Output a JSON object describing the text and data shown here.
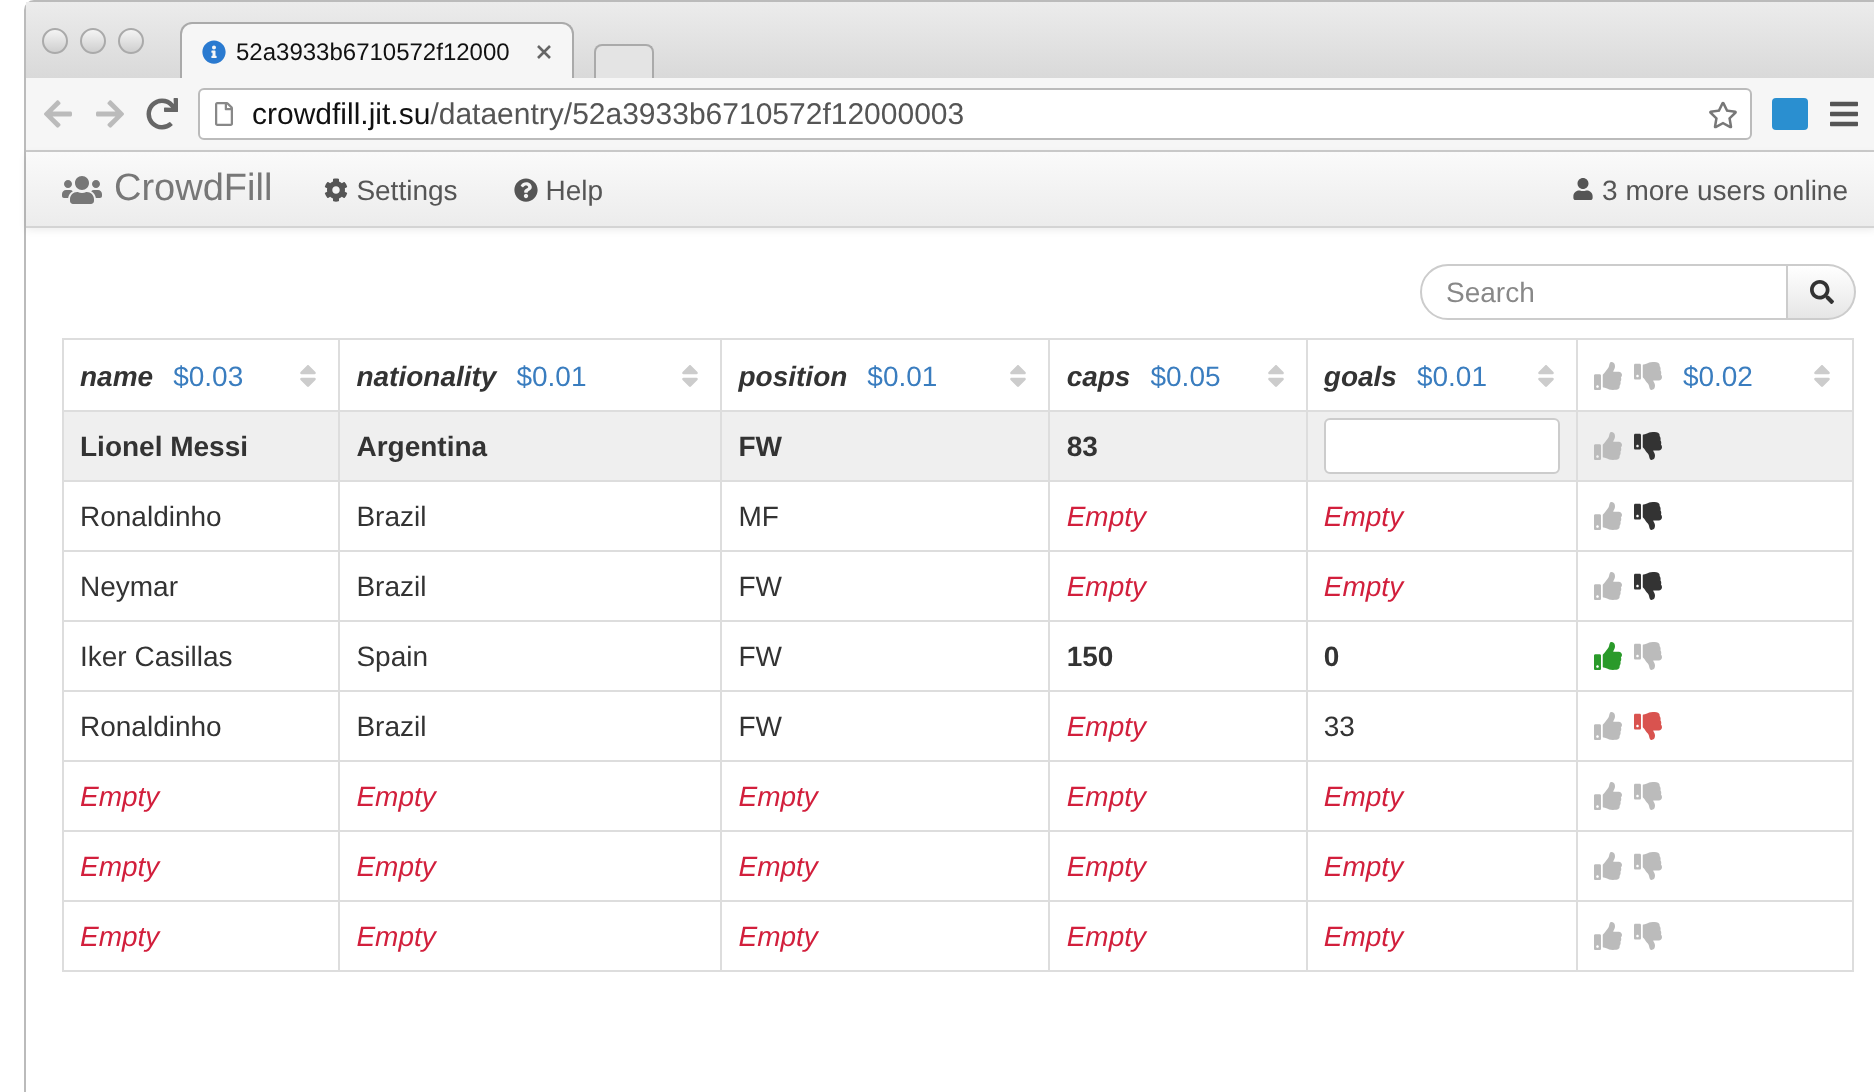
{
  "browser": {
    "tab_title": "52a3933b6710572f12000",
    "url_host": "crowdfill.jit.su",
    "url_path": "/dataentry/52a3933b6710572f12000003"
  },
  "navbar": {
    "brand": "CrowdFill",
    "links": [
      "Settings",
      "Help"
    ],
    "users_online": "3 more users online"
  },
  "search": {
    "placeholder": "Search"
  },
  "table": {
    "columns": [
      {
        "name": "name",
        "price": "$0.03"
      },
      {
        "name": "nationality",
        "price": "$0.01"
      },
      {
        "name": "position",
        "price": "$0.01"
      },
      {
        "name": "caps",
        "price": "$0.05"
      },
      {
        "name": "goals",
        "price": "$0.01"
      }
    ],
    "vote_price": "$0.02",
    "rows": [
      {
        "selected": true,
        "votes": [
          {
            "kind": "up",
            "color": "#bbbbbb"
          },
          {
            "kind": "down",
            "color": "#333333"
          }
        ],
        "cells": [
          {
            "kind": "value",
            "text": "Lionel Messi",
            "bold": true
          },
          {
            "kind": "value",
            "text": "Argentina",
            "bold": true
          },
          {
            "kind": "value",
            "text": "FW",
            "bold": true
          },
          {
            "kind": "value",
            "text": "83",
            "bold": true
          },
          {
            "kind": "input"
          }
        ]
      },
      {
        "selected": false,
        "votes": [
          {
            "kind": "up",
            "color": "#bbbbbb"
          },
          {
            "kind": "down",
            "color": "#333333"
          }
        ],
        "cells": [
          {
            "kind": "value",
            "text": "Ronaldinho",
            "bold": false
          },
          {
            "kind": "value",
            "text": "Brazil",
            "bold": false
          },
          {
            "kind": "value",
            "text": "MF",
            "bold": false
          },
          {
            "kind": "empty",
            "text": "Empty"
          },
          {
            "kind": "empty",
            "text": "Empty"
          }
        ]
      },
      {
        "selected": false,
        "votes": [
          {
            "kind": "up",
            "color": "#bbbbbb"
          },
          {
            "kind": "down",
            "color": "#333333"
          }
        ],
        "cells": [
          {
            "kind": "value",
            "text": "Neymar",
            "bold": false
          },
          {
            "kind": "value",
            "text": "Brazil",
            "bold": false
          },
          {
            "kind": "value",
            "text": "FW",
            "bold": false
          },
          {
            "kind": "empty",
            "text": "Empty"
          },
          {
            "kind": "empty",
            "text": "Empty"
          }
        ]
      },
      {
        "selected": false,
        "votes": [
          {
            "kind": "up",
            "color": "#2a9a2a"
          },
          {
            "kind": "down",
            "color": "#bbbbbb"
          }
        ],
        "cells": [
          {
            "kind": "value",
            "text": "Iker Casillas",
            "bold": false
          },
          {
            "kind": "value",
            "text": "Spain",
            "bold": false
          },
          {
            "kind": "value",
            "text": "FW",
            "bold": false
          },
          {
            "kind": "value",
            "text": "150",
            "bold": true
          },
          {
            "kind": "value",
            "text": "0",
            "bold": true
          }
        ]
      },
      {
        "selected": false,
        "votes": [
          {
            "kind": "up",
            "color": "#bbbbbb"
          },
          {
            "kind": "down",
            "color": "#d9534f"
          }
        ],
        "cells": [
          {
            "kind": "value",
            "text": "Ronaldinho",
            "bold": false
          },
          {
            "kind": "value",
            "text": "Brazil",
            "bold": false
          },
          {
            "kind": "value",
            "text": "FW",
            "bold": false
          },
          {
            "kind": "empty",
            "text": "Empty"
          },
          {
            "kind": "value",
            "text": "33",
            "bold": false
          }
        ]
      },
      {
        "selected": false,
        "votes": [
          {
            "kind": "up",
            "color": "#bbbbbb"
          },
          {
            "kind": "down",
            "color": "#bbbbbb"
          }
        ],
        "cells": [
          {
            "kind": "empty",
            "text": "Empty"
          },
          {
            "kind": "empty",
            "text": "Empty"
          },
          {
            "kind": "empty",
            "text": "Empty"
          },
          {
            "kind": "empty",
            "text": "Empty"
          },
          {
            "kind": "empty",
            "text": "Empty"
          }
        ]
      },
      {
        "selected": false,
        "votes": [
          {
            "kind": "up",
            "color": "#bbbbbb"
          },
          {
            "kind": "down",
            "color": "#bbbbbb"
          }
        ],
        "cells": [
          {
            "kind": "empty",
            "text": "Empty"
          },
          {
            "kind": "empty",
            "text": "Empty"
          },
          {
            "kind": "empty",
            "text": "Empty"
          },
          {
            "kind": "empty",
            "text": "Empty"
          },
          {
            "kind": "empty",
            "text": "Empty"
          }
        ]
      },
      {
        "selected": false,
        "votes": [
          {
            "kind": "up",
            "color": "#bbbbbb"
          },
          {
            "kind": "down",
            "color": "#bbbbbb"
          }
        ],
        "cells": [
          {
            "kind": "empty",
            "text": "Empty"
          },
          {
            "kind": "empty",
            "text": "Empty"
          },
          {
            "kind": "empty",
            "text": "Empty"
          },
          {
            "kind": "empty",
            "text": "Empty"
          },
          {
            "kind": "empty",
            "text": "Empty"
          }
        ]
      }
    ]
  }
}
